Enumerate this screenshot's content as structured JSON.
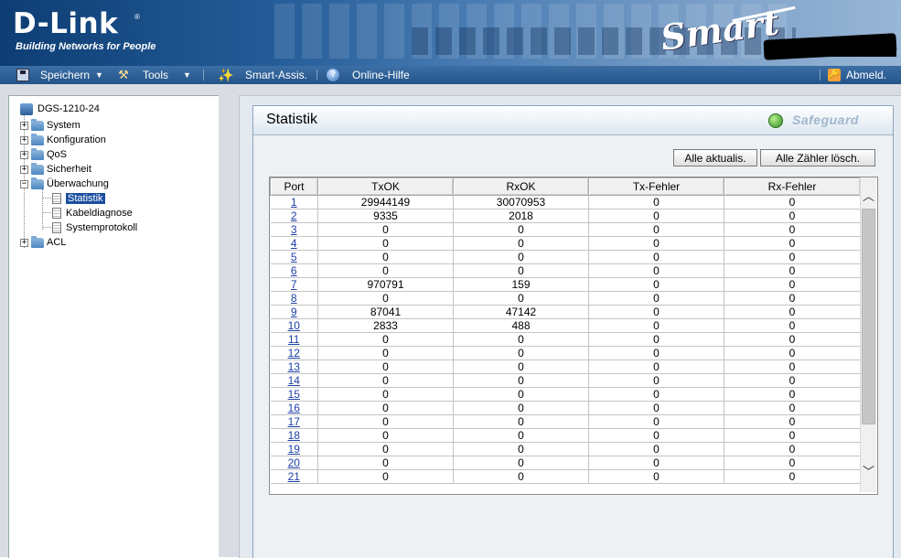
{
  "header": {
    "logo": "D-Link",
    "logo_mark": "®",
    "tagline": "Building Networks for People",
    "product": "Smart"
  },
  "menubar": {
    "save": "Speichern",
    "tools": "Tools",
    "wizard": "Smart-Assis.",
    "help": "Online-Hilfe",
    "logout": "Abmeld."
  },
  "tree": {
    "root": "DGS-1210-24",
    "items": [
      {
        "label": "System"
      },
      {
        "label": "Konfiguration"
      },
      {
        "label": "QoS"
      },
      {
        "label": "Sicherheit"
      },
      {
        "label": "Überwachung"
      },
      {
        "label": "Statistik",
        "selected": true
      },
      {
        "label": "Kabeldiagnose"
      },
      {
        "label": "Systemprotokoll"
      },
      {
        "label": "ACL"
      }
    ]
  },
  "panel": {
    "title": "Statistik",
    "safeguard": "Safeguard",
    "refresh_button": "Alle aktualis.",
    "clear_button": "Alle Zähler lösch."
  },
  "table": {
    "headers": [
      "Port",
      "TxOK",
      "RxOK",
      "Tx-Fehler",
      "Rx-Fehler"
    ],
    "rows": [
      [
        "1",
        "29944149",
        "30070953",
        "0",
        "0"
      ],
      [
        "2",
        "9335",
        "2018",
        "0",
        "0"
      ],
      [
        "3",
        "0",
        "0",
        "0",
        "0"
      ],
      [
        "4",
        "0",
        "0",
        "0",
        "0"
      ],
      [
        "5",
        "0",
        "0",
        "0",
        "0"
      ],
      [
        "6",
        "0",
        "0",
        "0",
        "0"
      ],
      [
        "7",
        "970791",
        "159",
        "0",
        "0"
      ],
      [
        "8",
        "0",
        "0",
        "0",
        "0"
      ],
      [
        "9",
        "87041",
        "47142",
        "0",
        "0"
      ],
      [
        "10",
        "2833",
        "488",
        "0",
        "0"
      ],
      [
        "11",
        "0",
        "0",
        "0",
        "0"
      ],
      [
        "12",
        "0",
        "0",
        "0",
        "0"
      ],
      [
        "13",
        "0",
        "0",
        "0",
        "0"
      ],
      [
        "14",
        "0",
        "0",
        "0",
        "0"
      ],
      [
        "15",
        "0",
        "0",
        "0",
        "0"
      ],
      [
        "16",
        "0",
        "0",
        "0",
        "0"
      ],
      [
        "17",
        "0",
        "0",
        "0",
        "0"
      ],
      [
        "18",
        "0",
        "0",
        "0",
        "0"
      ],
      [
        "19",
        "0",
        "0",
        "0",
        "0"
      ],
      [
        "20",
        "0",
        "0",
        "0",
        "0"
      ],
      [
        "21",
        "0",
        "0",
        "0",
        "0"
      ]
    ]
  },
  "icons": {
    "save": "save-icon",
    "tools": "tools-icon",
    "wizard": "wizard-icon",
    "help": "help-icon",
    "logout": "logout-icon",
    "scroll_up": "chevron-up-icon",
    "scroll_down": "chevron-down-icon"
  },
  "colors": {
    "header_bg": "#245c98",
    "menubar_bg": "#2f619a",
    "link": "#1d3fa8",
    "selected": "#1a4fa0",
    "safeguard_led": "#2f8a1e"
  }
}
